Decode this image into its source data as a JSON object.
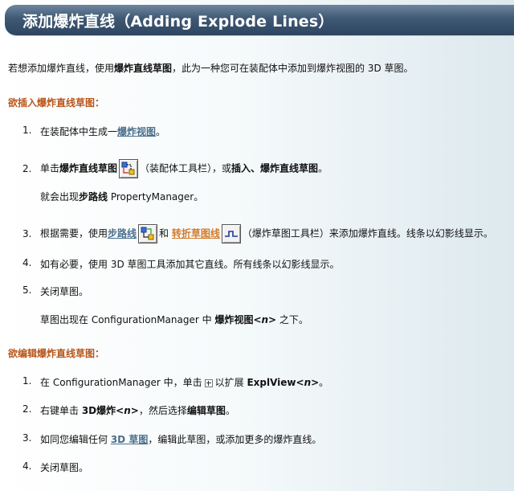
{
  "title": "添加爆炸直线（Adding Explode Lines）",
  "intro": {
    "part1": "若想添加爆炸直线，使用",
    "bold1": "爆炸直线草图",
    "part2": "，此为一种您可在装配体中添加到爆炸视图的 3D 草图。"
  },
  "section_insert": "欲插入爆炸直线草图：",
  "insert_steps": [
    {
      "num": "1.",
      "a": "在装配体中生成一",
      "link": "爆炸视图",
      "b": "。"
    },
    {
      "num": "2.",
      "a": "单击",
      "bold": "爆炸直线草图",
      "b": "（装配体工具栏），或",
      "bold2": "插入、爆炸直线草图",
      "c": "。",
      "sub": "就会出现",
      "sub_bold": "步路线",
      "sub_rest": " PropertyManager。"
    },
    {
      "num": "3.",
      "a": "根据需要，使用",
      "link1": "步路线",
      "mid": "和",
      "link2": "转折草图线",
      "b": "（爆炸草图工具栏）来添加爆炸直线。线条以幻影线显示。"
    },
    {
      "num": "4.",
      "a": "如有必要，使用 3D 草图工具添加其它直线。所有线条以幻影线显示。"
    },
    {
      "num": "5.",
      "a": "关闭草图。",
      "sub": "草图出现在 ConfigurationManager 中 ",
      "sub_bold": "爆炸视图<",
      "sub_italic": "n",
      "sub_bold2": ">",
      "sub_rest": " 之下。"
    }
  ],
  "section_edit": "欲编辑爆炸直线草图：",
  "edit_steps": [
    {
      "num": "1.",
      "a": "在 ConfigurationManager 中，单击",
      "b": "以扩展 ",
      "bold": "ExplView<",
      "italic": "n",
      "bold2": ">",
      "c": "。"
    },
    {
      "num": "2.",
      "a": "右键单击 ",
      "bold": "3D爆炸<",
      "italic": "n",
      "bold2": ">",
      "b": "，然后选择",
      "bold3": "编辑草图",
      "c": "。"
    },
    {
      "num": "3.",
      "a": "如同您编辑任何 ",
      "link": "3D 草图",
      "b": "，编辑此草图，或添加更多的爆炸直线。"
    },
    {
      "num": "4.",
      "a": "关闭草图。"
    }
  ],
  "icons": {
    "explode_line_sketch": "explode-line-sketch-icon",
    "route_line": "route-line-icon",
    "jog_line": "jog-line-icon",
    "expand": "plus-expand-icon"
  }
}
